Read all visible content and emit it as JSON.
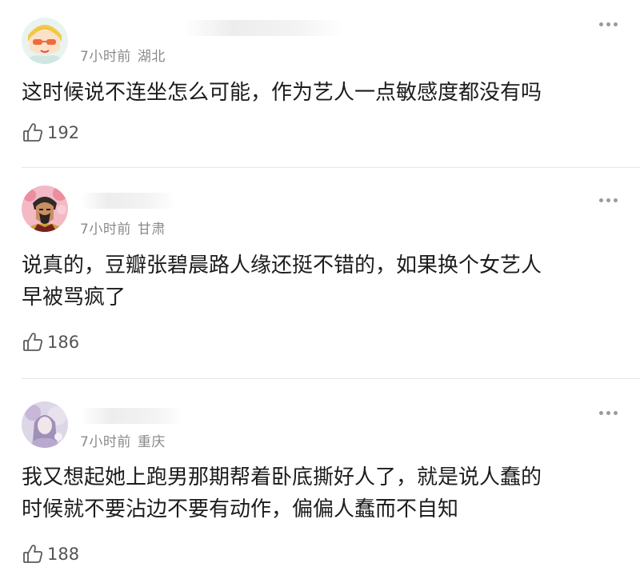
{
  "comments": [
    {
      "username": "",
      "time": "7小时前",
      "location": "湖北",
      "text_lines": [
        "这时候说不连坐怎么可能，作为艺人一点敏感度都没有吗"
      ],
      "likes": "192"
    },
    {
      "username": "",
      "time": "7小时前",
      "location": "甘肃",
      "text_lines": [
        "说真的，豆瓣张碧晨路人缘还挺不错的，如果换个女艺人",
        "早被骂疯了"
      ],
      "likes": "186"
    },
    {
      "username": "",
      "time": "7小时前",
      "location": "重庆",
      "text_lines": [
        "我又想起她上跑男那期帮着卧底撕好人了，就是说人蠢的",
        "时候就不要沾边不要有动作，偏偏人蠢而不自知"
      ],
      "likes": "188"
    }
  ],
  "icons": {
    "more": "more-dots-icon",
    "like": "thumbs-up-icon"
  },
  "colors": {
    "meta_text": "#8a8a8a",
    "body_text": "#1c1c1c",
    "divider": "#e6e6e6"
  }
}
